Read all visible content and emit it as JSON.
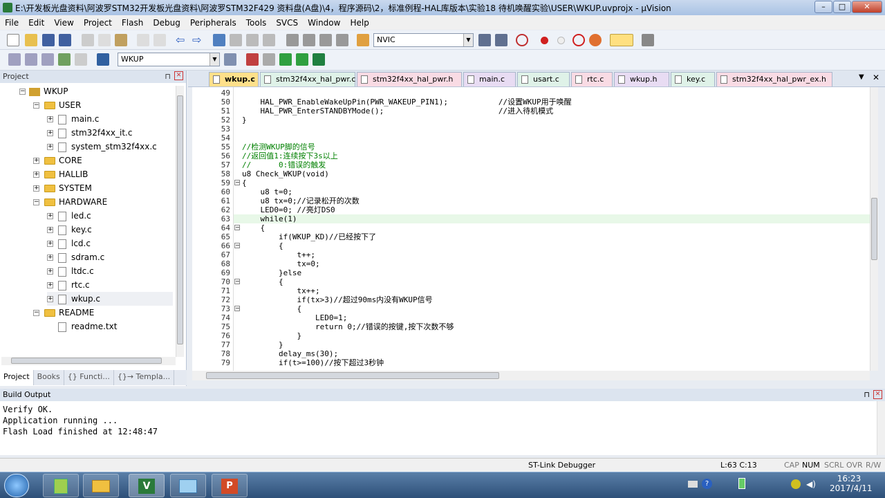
{
  "window": {
    "title": "E:\\开发板光盘资料\\阿波罗STM32开发板光盘资料\\阿波罗STM32F429 资料盘(A盘)\\4，程序源码\\2，标准例程-HAL库版本\\实验18 待机唤醒实验\\USER\\WKUP.uvprojx - µVision"
  },
  "menu": [
    "File",
    "Edit",
    "View",
    "Project",
    "Flash",
    "Debug",
    "Peripherals",
    "Tools",
    "SVCS",
    "Window",
    "Help"
  ],
  "toolbar": {
    "find_value": "NVIC",
    "target_value": "WKUP"
  },
  "project": {
    "title": "Project",
    "root": "WKUP",
    "groups": [
      {
        "name": "USER",
        "files": [
          "main.c",
          "stm32f4xx_it.c",
          "system_stm32f4xx.c"
        ]
      },
      {
        "name": "CORE"
      },
      {
        "name": "HALLIB"
      },
      {
        "name": "SYSTEM"
      },
      {
        "name": "HARDWARE",
        "files": [
          "led.c",
          "key.c",
          "lcd.c",
          "sdram.c",
          "ltdc.c",
          "rtc.c",
          "wkup.c"
        ]
      },
      {
        "name": "README",
        "files": [
          "readme.txt"
        ]
      }
    ],
    "tabs": [
      "Project",
      "Books",
      "{} Functi...",
      "{}→ Templa..."
    ]
  },
  "editor": {
    "tabs": [
      "wkup.c",
      "stm32f4xx_hal_pwr.c",
      "stm32f4xx_hal_pwr.h",
      "main.c",
      "usart.c",
      "rtc.c",
      "wkup.h",
      "key.c",
      "stm32f4xx_hal_pwr_ex.h"
    ],
    "lines": [
      {
        "n": "49",
        "t": ""
      },
      {
        "n": "50",
        "t": "    HAL_PWR_EnableWakeUpPin(PWR_WAKEUP_PIN1);           //设置WKUP用于唤醒"
      },
      {
        "n": "51",
        "t": "    HAL_PWR_EnterSTANDBYMode();                         //进入待机模式"
      },
      {
        "n": "52",
        "t": "}"
      },
      {
        "n": "53",
        "t": ""
      },
      {
        "n": "54",
        "t": ""
      },
      {
        "n": "55",
        "t": "//检测WKUP脚的信号"
      },
      {
        "n": "56",
        "t": "//返回值1:连续按下3s以上"
      },
      {
        "n": "57",
        "t": "//      0:错误的触发"
      },
      {
        "n": "58",
        "t": "u8 Check_WKUP(void)"
      },
      {
        "n": "59",
        "t": "{"
      },
      {
        "n": "60",
        "t": "    u8 t=0;"
      },
      {
        "n": "61",
        "t": "    u8 tx=0;//记录松开的次数"
      },
      {
        "n": "62",
        "t": "    LED0=0; //亮灯DS0"
      },
      {
        "n": "63",
        "t": "    while(1)"
      },
      {
        "n": "64",
        "t": "    {"
      },
      {
        "n": "65",
        "t": "        if(WKUP_KD)//已经按下了"
      },
      {
        "n": "66",
        "t": "        {"
      },
      {
        "n": "67",
        "t": "            t++;"
      },
      {
        "n": "68",
        "t": "            tx=0;"
      },
      {
        "n": "69",
        "t": "        }else"
      },
      {
        "n": "70",
        "t": "        {"
      },
      {
        "n": "71",
        "t": "            tx++;"
      },
      {
        "n": "72",
        "t": "            if(tx>3)//超过90ms内没有WKUP信号"
      },
      {
        "n": "73",
        "t": "            {"
      },
      {
        "n": "74",
        "t": "                LED0=1;"
      },
      {
        "n": "75",
        "t": "                return 0;//错误的按键,按下次数不够"
      },
      {
        "n": "76",
        "t": "            }"
      },
      {
        "n": "77",
        "t": "        }"
      },
      {
        "n": "78",
        "t": "        delay_ms(30);"
      },
      {
        "n": "79",
        "t": "        if(t>=100)//按下超过3秒钟"
      }
    ]
  },
  "build": {
    "title": "Build Output",
    "lines": [
      "Verify OK.",
      "Application running ...",
      "Flash Load finished at 12:48:47"
    ]
  },
  "status": {
    "debugger": "ST-Link Debugger",
    "position": "L:63 C:13",
    "caps": "CAP",
    "num": "NUM",
    "scrl": "SCRL",
    "ovr": "OVR",
    "rw": "R/W"
  },
  "taskbar": {
    "time": "16:23",
    "date": "2017/4/11"
  },
  "colors": {
    "active_tab": "#ffe08a",
    "comment": "#008000",
    "keyword": "#0000ff",
    "number": "#800080"
  }
}
